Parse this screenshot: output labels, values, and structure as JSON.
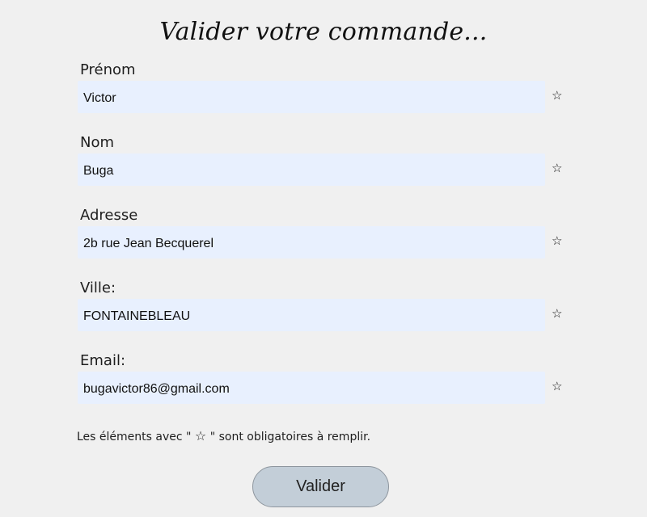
{
  "title": "Valider votre commande...",
  "fields": [
    {
      "label": "Prénom",
      "value": "Victor",
      "required_icon": "☆"
    },
    {
      "label": "Nom",
      "value": "Buga",
      "required_icon": "☆"
    },
    {
      "label": "Adresse",
      "value": "2b rue Jean Becquerel",
      "required_icon": "☆"
    },
    {
      "label": "Ville:",
      "value": "FONTAINEBLEAU",
      "required_icon": "☆"
    },
    {
      "label": "Email:",
      "value": "bugavictor86@gmail.com",
      "required_icon": "☆"
    }
  ],
  "note": {
    "before": "Les éléments avec \" ",
    "star": "☆",
    "after": " \" sont obligatoires à remplir."
  },
  "submit_label": "Valider",
  "colors": {
    "background": "#f0f0f0",
    "input_background": "#e8f0fe",
    "button_background": "#c3ced8"
  }
}
